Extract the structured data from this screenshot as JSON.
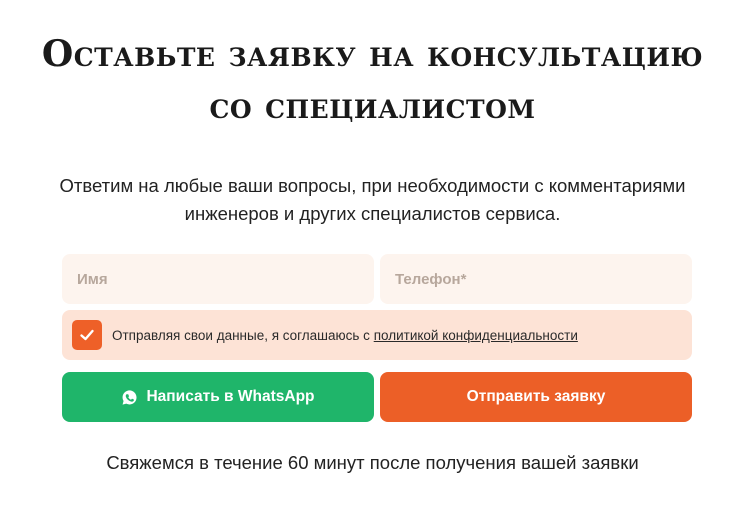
{
  "heading": {
    "title": "Оставьте заявку на консультацию со специалистом",
    "subtitle": "Ответим на любые ваши вопросы, при необходимости с комментариями инженеров и других специалистов сервиса."
  },
  "form": {
    "name_placeholder": "Имя",
    "phone_placeholder": "Телефон*",
    "consent_text": "Отправляя свои данные, я соглашаюсь с",
    "consent_link": "политикой конфиденциальности",
    "consent_checked": true,
    "whatsapp_label": "Написать в WhatsApp",
    "submit_label": "Отправить заявку"
  },
  "footer": {
    "note": "Свяжемся в течение 60 минут после получения вашей заявки"
  },
  "colors": {
    "accent": "#ec5f27",
    "whatsapp": "#1fb56a",
    "field_bg": "#fdf4ee",
    "consent_bg": "#fde3d6"
  },
  "icons": {
    "checkbox": "check-icon",
    "whatsapp": "whatsapp-icon"
  }
}
